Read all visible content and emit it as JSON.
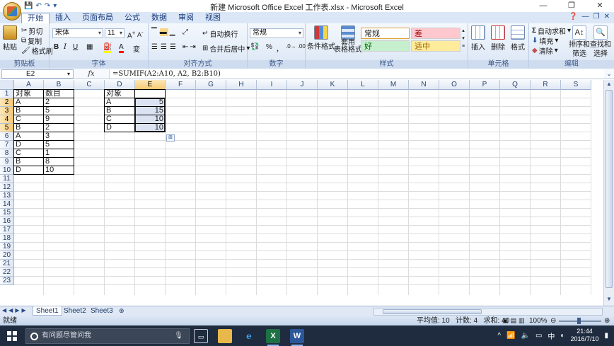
{
  "window": {
    "title": "新建 Microsoft Office Excel 工作表.xlsx - Microsoft Excel",
    "controls": [
      "—",
      "❐",
      "✕"
    ]
  },
  "ribbon_tabs": [
    "开始",
    "插入",
    "页面布局",
    "公式",
    "数据",
    "审阅",
    "视图"
  ],
  "active_tab": "开始",
  "clipboard": {
    "paste": "粘贴",
    "cut": "剪切",
    "copy": "复制",
    "format_painter": "格式刷",
    "label": "剪贴板"
  },
  "font": {
    "name": "宋体",
    "size": "11",
    "label": "字体",
    "bold": "B",
    "italic": "I",
    "underline": "U"
  },
  "alignment": {
    "wrap": "自动换行",
    "merge": "合并后居中",
    "label": "对齐方式"
  },
  "number": {
    "format": "常规",
    "percent": "%",
    "comma": "，",
    "label": "数字"
  },
  "styles": {
    "conditional": "条件格式",
    "table": "套用",
    "table2": "表格格式",
    "normal": "常规",
    "bad": "差",
    "good": "好",
    "neutral": "适中",
    "label": "样式",
    "colors": {
      "bad_bg": "#ffc7ce",
      "good_bg": "#c6efce",
      "neutral_bg": "#ffeb9c"
    }
  },
  "cells_group": {
    "insert": "插入",
    "delete": "删除",
    "format": "格式",
    "label": "单元格"
  },
  "editing": {
    "autosum": "自动求和",
    "fill": "填充",
    "clear": "清除",
    "sort": "排序和",
    "sort2": "筛选",
    "find": "查找和",
    "find2": "选择",
    "label": "编辑"
  },
  "formula_bar": {
    "name_box": "E2",
    "fx": "fx",
    "formula": "=SUMIF(A2:A10, A2, B2:B10)"
  },
  "columns": [
    "A",
    "B",
    "C",
    "D",
    "E",
    "F",
    "G",
    "H",
    "I",
    "J",
    "K",
    "L",
    "M",
    "N",
    "O",
    "P",
    "Q",
    "R",
    "S"
  ],
  "rows": [
    "1",
    "2",
    "3",
    "4",
    "5",
    "6",
    "7",
    "8",
    "9",
    "10",
    "11",
    "12",
    "13",
    "14",
    "15",
    "16",
    "17",
    "18",
    "19",
    "20",
    "21",
    "22",
    "23"
  ],
  "data_ab": [
    [
      "对象",
      "数目"
    ],
    [
      "A",
      "2"
    ],
    [
      "B",
      "5"
    ],
    [
      "C",
      "9"
    ],
    [
      "B",
      "2"
    ],
    [
      "A",
      "3"
    ],
    [
      "D",
      "5"
    ],
    [
      "C",
      "1"
    ],
    [
      "B",
      "8"
    ],
    [
      "D",
      "10"
    ]
  ],
  "data_de": [
    [
      "对象",
      ""
    ],
    [
      "A",
      "5"
    ],
    [
      "B",
      "15"
    ],
    [
      "C",
      "10"
    ],
    [
      "D",
      "10"
    ]
  ],
  "sheets": [
    "Sheet1",
    "Sheet2",
    "Sheet3"
  ],
  "active_sheet": "Sheet1",
  "status": {
    "mode": "就绪",
    "average": "平均值: 10",
    "count": "计数: 4",
    "sum": "求和: 40",
    "zoom": "100%"
  },
  "taskbar": {
    "search_placeholder": "有问题尽管问我",
    "time": "21:44",
    "date": "2016/7/10",
    "ime": "中"
  }
}
